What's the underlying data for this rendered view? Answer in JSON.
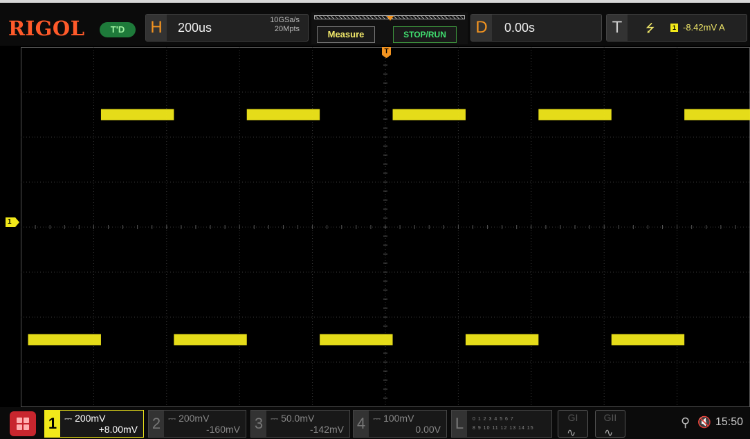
{
  "header": {
    "brand": "RIGOL",
    "run_state": "T'D",
    "horizontal": {
      "letter": "H",
      "timebase": "200us",
      "sample_rate": "10GSa/s",
      "memory_depth": "20Mpts"
    },
    "buttons": {
      "measure": "Measure",
      "stop_run": "STOP/RUN"
    },
    "delay": {
      "letter": "D",
      "value": "0.00s"
    },
    "trigger": {
      "letter": "T",
      "edge_symbol": "⭍",
      "source": "1",
      "level": "-8.42mV A"
    }
  },
  "markers": {
    "channel1": "1",
    "trigger_position": "T"
  },
  "channels": [
    {
      "num": "1",
      "coupling_symbol": "⎓",
      "scale": "200mV",
      "offset": "+8.00mV",
      "active": true
    },
    {
      "num": "2",
      "coupling_symbol": "⎓",
      "scale": "200mV",
      "offset": "-160mV",
      "active": false
    },
    {
      "num": "3",
      "coupling_symbol": "⎓",
      "scale": "50.0mV",
      "offset": "-142mV",
      "active": false
    },
    {
      "num": "4",
      "coupling_symbol": "⎓",
      "scale": "100mV",
      "offset": "0.00V",
      "active": false
    }
  ],
  "logic": {
    "letter": "L",
    "row1": "0 1 2 3 4 5 6 7",
    "row2": "8 9 10 11 12 13 14 15"
  },
  "generators": [
    {
      "label": "GI",
      "wave": "∿"
    },
    {
      "label": "GII",
      "wave": "∿"
    }
  ],
  "status": {
    "clock": "15:50"
  },
  "colors": {
    "ch1": "#f1e81a",
    "trigger": "#f39420",
    "brand": "#ff5a2a",
    "run": "#40e070"
  },
  "waveform": {
    "type": "square",
    "high_level_div": 2.5,
    "low_level_div": -2.5,
    "period_div": 2.0,
    "first_rising_edge_div": -3.9,
    "color": "#f1e81a"
  }
}
